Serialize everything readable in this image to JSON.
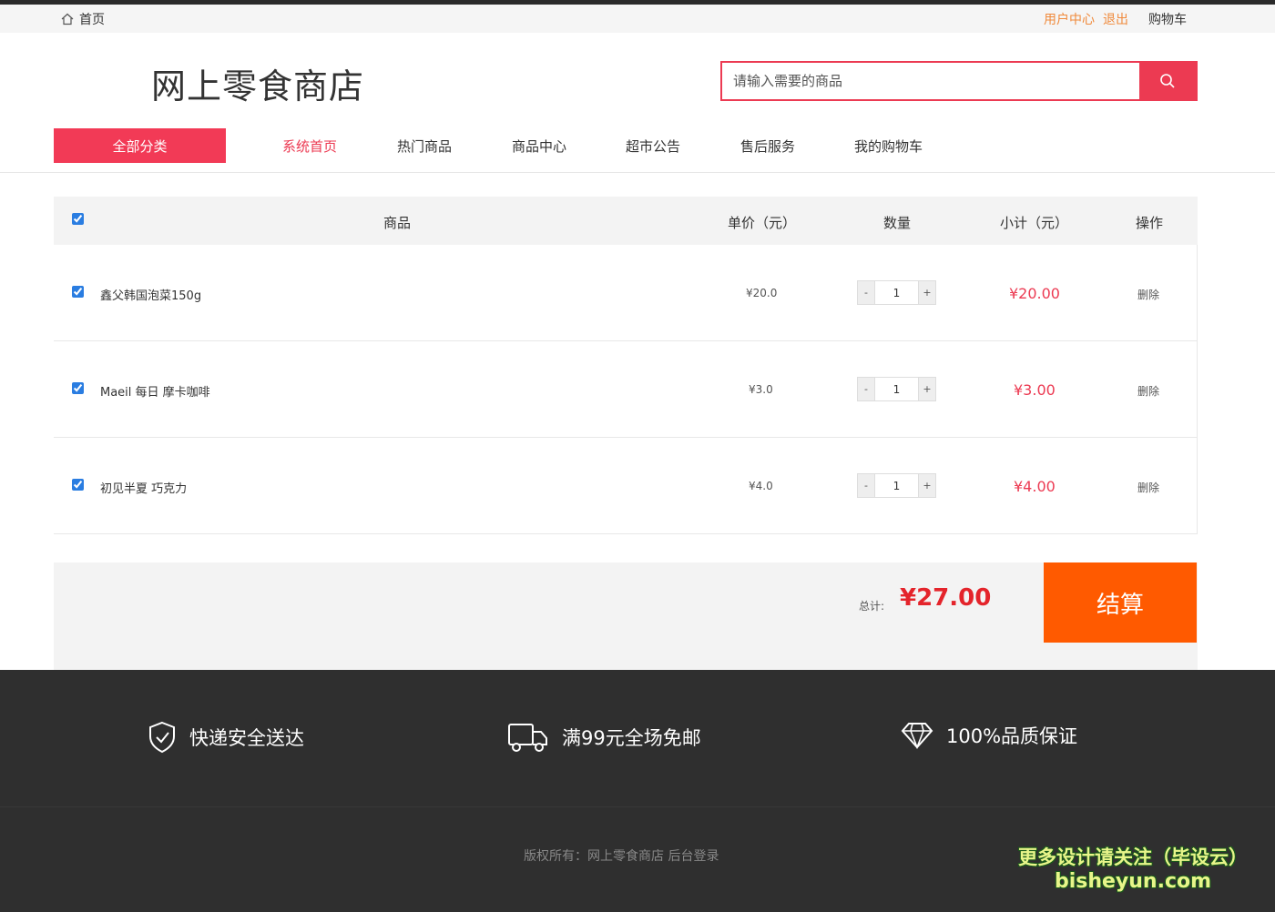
{
  "topbar": {
    "home_label": "首页",
    "user_center": "用户中心",
    "logout": "退出",
    "cart": "购物车"
  },
  "brand": {
    "title": "网上零食商店"
  },
  "search": {
    "placeholder": "请输入需要的商品"
  },
  "nav": {
    "all_categories": "全部分类",
    "items": [
      "系统首页",
      "热门商品",
      "商品中心",
      "超市公告",
      "售后服务",
      "我的购物车"
    ]
  },
  "cart_table": {
    "headers": {
      "product": "商品",
      "unit_price": "单价（元）",
      "quantity": "数量",
      "subtotal": "小计（元）",
      "action": "操作"
    },
    "rows": [
      {
        "name": "鑫父韩国泡菜150g",
        "price": "¥20.0",
        "qty": "1",
        "subtotal": "¥20.00",
        "action": "删除",
        "checked": true
      },
      {
        "name": "Maeil 每日 摩卡咖啡",
        "price": "¥3.0",
        "qty": "1",
        "subtotal": "¥3.00",
        "action": "删除",
        "checked": true
      },
      {
        "name": "初见半夏 巧克力",
        "price": "¥4.0",
        "qty": "1",
        "subtotal": "¥4.00",
        "action": "删除",
        "checked": true
      }
    ],
    "stepper": {
      "minus": "-",
      "plus": "+"
    }
  },
  "summary": {
    "total_label": "总计:",
    "total": "¥27.00",
    "checkout": "结算"
  },
  "footer": {
    "features": [
      "快递安全送达",
      "满99元全场免邮",
      "100%品质保证"
    ],
    "copyright": "版权所有：网上零食商店 后台登录",
    "watermark_line1": "更多设计请关注（毕设云）",
    "watermark_line2": "bisheyun.com"
  },
  "colors": {
    "accent": "#ec3a52",
    "checkout": "#ff5a00",
    "total": "#e4242b",
    "footer_bg": "#2f2f2f"
  }
}
